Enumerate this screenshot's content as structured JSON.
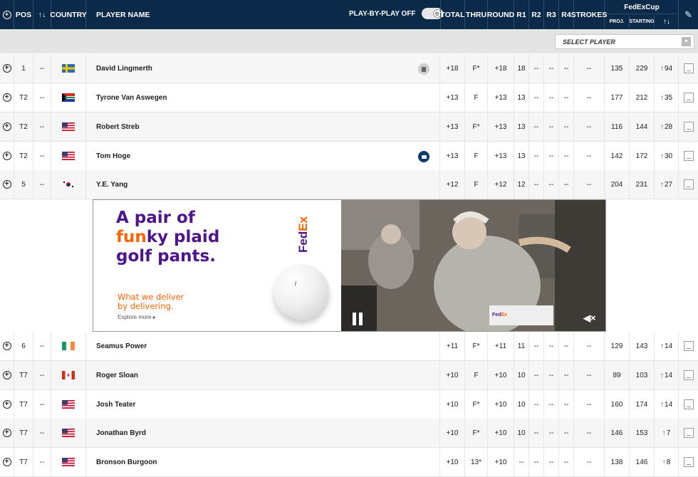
{
  "header": {
    "pos": "POS",
    "move": "↑↓",
    "country": "COUNTRY",
    "player_name": "PLAYER NAME",
    "play_by_play": "PLAY-BY-PLAY OFF",
    "total": "TOTAL",
    "thru": "THRU",
    "round": "ROUND",
    "r1": "R1",
    "r2": "R2",
    "r3": "R3",
    "r4": "R4",
    "strokes": "STROKES",
    "fedex": "FedExCup",
    "proj": "PROJ.",
    "starting": "STARTING",
    "fedex_move": "↑↓"
  },
  "filter": {
    "select_player": "SELECT PLAYER",
    "caret": "▼"
  },
  "rows": [
    {
      "pos": "1",
      "move": "--",
      "name": "David Lingmerth",
      "total": "+18",
      "thru": "F*",
      "round": "+18",
      "r1": "18",
      "r2": "--",
      "r3": "--",
      "r4": "--",
      "strokes": "--",
      "proj": "135",
      "starting": "229",
      "mv": "94"
    },
    {
      "pos": "T2",
      "move": "--",
      "name": "Tyrone Van Aswegen",
      "total": "+13",
      "thru": "F",
      "round": "+13",
      "r1": "13",
      "r2": "--",
      "r3": "--",
      "r4": "--",
      "strokes": "--",
      "proj": "177",
      "starting": "212",
      "mv": "35"
    },
    {
      "pos": "T2",
      "move": "--",
      "name": "Robert Streb",
      "total": "+13",
      "thru": "F*",
      "round": "+13",
      "r1": "13",
      "r2": "--",
      "r3": "--",
      "r4": "--",
      "strokes": "--",
      "proj": "116",
      "starting": "144",
      "mv": "28"
    },
    {
      "pos": "T2",
      "move": "--",
      "name": "Tom Hoge",
      "total": "+13",
      "thru": "F",
      "round": "+13",
      "r1": "13",
      "r2": "--",
      "r3": "--",
      "r4": "--",
      "strokes": "--",
      "proj": "142",
      "starting": "172",
      "mv": "30"
    },
    {
      "pos": "5",
      "move": "--",
      "name": "Y.E. Yang",
      "total": "+12",
      "thru": "F",
      "round": "+12",
      "r1": "12",
      "r2": "--",
      "r3": "--",
      "r4": "--",
      "strokes": "--",
      "proj": "204",
      "starting": "231",
      "mv": "27"
    },
    {
      "pos": "6",
      "move": "--",
      "name": "Seamus Power",
      "total": "+11",
      "thru": "F*",
      "round": "+11",
      "r1": "11",
      "r2": "--",
      "r3": "--",
      "r4": "--",
      "strokes": "--",
      "proj": "129",
      "starting": "143",
      "mv": "14"
    },
    {
      "pos": "T7",
      "move": "--",
      "name": "Roger Sloan",
      "total": "+10",
      "thru": "F",
      "round": "+10",
      "r1": "10",
      "r2": "--",
      "r3": "--",
      "r4": "--",
      "strokes": "--",
      "proj": "89",
      "starting": "103",
      "mv": "14"
    },
    {
      "pos": "T7",
      "move": "--",
      "name": "Josh Teater",
      "total": "+10",
      "thru": "F*",
      "round": "+10",
      "r1": "10",
      "r2": "--",
      "r3": "--",
      "r4": "--",
      "strokes": "--",
      "proj": "160",
      "starting": "174",
      "mv": "14"
    },
    {
      "pos": "T7",
      "move": "--",
      "name": "Jonathan Byrd",
      "total": "+10",
      "thru": "F*",
      "round": "+10",
      "r1": "10",
      "r2": "--",
      "r3": "--",
      "r4": "--",
      "strokes": "--",
      "proj": "146",
      "starting": "153",
      "mv": "7"
    },
    {
      "pos": "T7",
      "move": "--",
      "name": "Bronson Burgoon",
      "total": "+10",
      "thru": "13*",
      "round": "+10",
      "r1": "--",
      "r2": "--",
      "r3": "--",
      "r4": "--",
      "strokes": "--",
      "proj": "138",
      "starting": "146",
      "mv": "8"
    }
  ],
  "ad": {
    "line1": "A pair of",
    "line2_a": "fun",
    "line2_b": "ky plaid",
    "line3": "golf pants.",
    "tag1": "What we deliver",
    "tag2": "by delivering.",
    "more": "Explore more ▸",
    "brand": "FedEx",
    "mute": "◀×"
  },
  "colors": {
    "header_bg": "#0b2a4a",
    "up_arrow": "#2a8a2a",
    "fedex_purple": "#4d148c",
    "fedex_orange": "#ff6200"
  }
}
